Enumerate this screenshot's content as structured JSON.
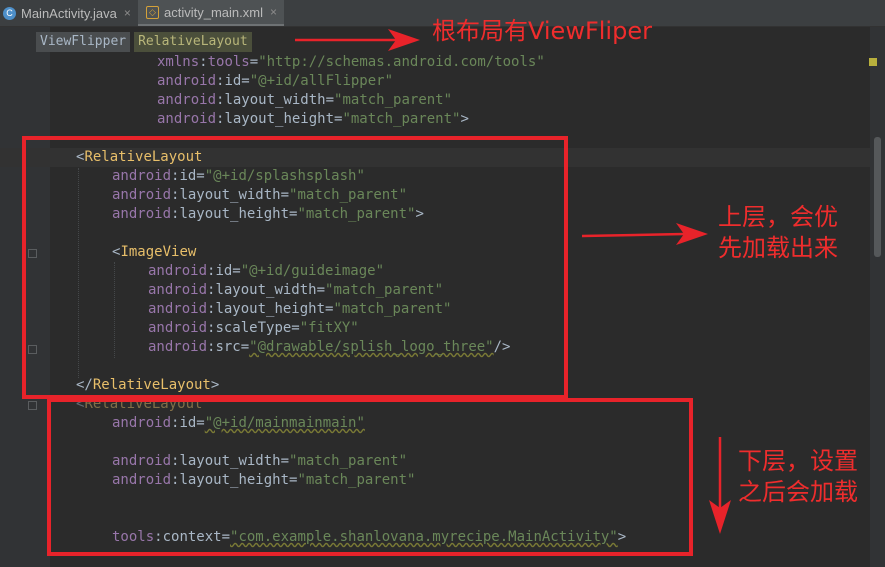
{
  "tabs": [
    {
      "icon": "C",
      "icon_name": "java-class-icon",
      "label": "MainActivity.java",
      "close": "×"
    },
    {
      "icon": "</>",
      "icon_name": "xml-file-icon",
      "label": "activity_main.xml",
      "close": "×"
    }
  ],
  "breadcrumb": [
    "ViewFlipper",
    "RelativeLayout"
  ],
  "code": {
    "l1": {
      "a": "xmlns",
      "b": ":",
      "c": "tools",
      "d": "=",
      "e": "\"http://schemas.android.com/tools\""
    },
    "l2": {
      "a": "android",
      "b": ":id=",
      "c": "\"@+id/allFlipper\""
    },
    "l3": {
      "a": "android",
      "b": ":layout_width=",
      "c": "\"match_parent\""
    },
    "l4": {
      "a": "android",
      "b": ":layout_height=",
      "c": "\"match_parent\"",
      "d": ">"
    },
    "l5": {
      "a": "<",
      "b": "RelativeLayout"
    },
    "l6": {
      "a": "android",
      "b": ":id=",
      "c": "\"@+id/splashsplash\""
    },
    "l7": {
      "a": "android",
      "b": ":layout_width=",
      "c": "\"match_parent\""
    },
    "l8": {
      "a": "android",
      "b": ":layout_height=",
      "c": "\"match_parent\"",
      "d": ">"
    },
    "l9": {
      "a": "<",
      "b": "ImageView"
    },
    "l10": {
      "a": "android",
      "b": ":id=",
      "c": "\"@+id/guideimage\""
    },
    "l11": {
      "a": "android",
      "b": ":layout_width=",
      "c": "\"match_parent\""
    },
    "l12": {
      "a": "android",
      "b": ":layout_height=",
      "c": "\"match_parent\""
    },
    "l13": {
      "a": "android",
      "b": ":scaleType=",
      "c": "\"fitXY\""
    },
    "l14": {
      "a": "android",
      "b": ":src=",
      "c": "\"@drawable/splish_logo_three\"",
      "d": "/>"
    },
    "l15": {
      "a": "</",
      "b": "RelativeLayout",
      "c": ">"
    },
    "l16": {
      "a": "<",
      "b": "RelativeLayout"
    },
    "l17": {
      "a": "android",
      "b": ":id=",
      "c": "\"@+id/mainmainmain\""
    },
    "l18": {
      "a": "android",
      "b": ":layout_width=",
      "c": "\"match_parent\""
    },
    "l19": {
      "a": "android",
      "b": ":layout_height=",
      "c": "\"match_parent\""
    },
    "l20": {
      "a": "tools",
      "b": ":context=",
      "c": "\"com.example.shanlovana.myrecipe.MainActivity\"",
      "d": ">"
    }
  },
  "annotations": {
    "root": "根布局有ViewFliper",
    "upper": "上层，会优\n先加载出来",
    "lower": "下层，设置\n之后会加载"
  },
  "colors": {
    "annotation": "#e8232a",
    "background": "#2b2b2b",
    "string": "#6a8759",
    "tag": "#e8bf6a"
  }
}
